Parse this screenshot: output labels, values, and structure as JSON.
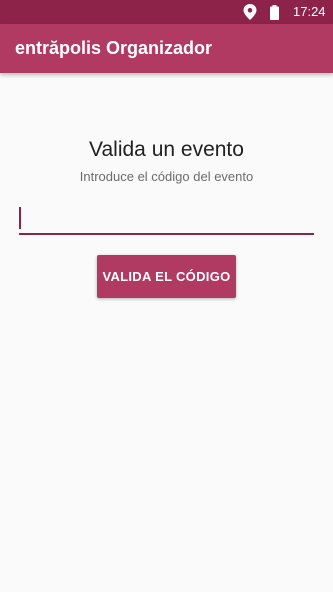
{
  "status_bar": {
    "time": "17:24",
    "icons": [
      "location-icon",
      "battery-icon"
    ]
  },
  "app_bar": {
    "title": "entrăpolis Organizador"
  },
  "main": {
    "heading": "Valida un evento",
    "subheading": "Introduce el código del evento",
    "code_input": {
      "value": "",
      "placeholder": ""
    },
    "validate_button_label": "VALIDA EL CÓDIGO"
  },
  "colors": {
    "status_bar": "#8e2349",
    "app_bar": "#b03a62",
    "accent": "#8e2349",
    "button": "#b03a62",
    "background": "#fafafa"
  }
}
